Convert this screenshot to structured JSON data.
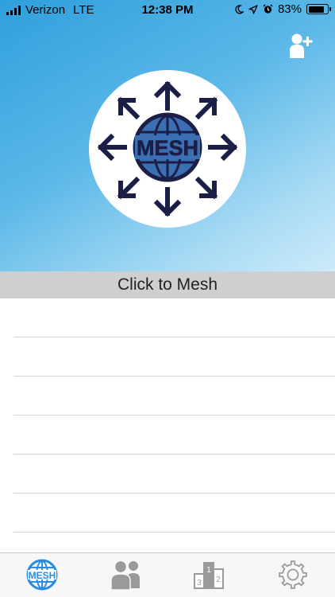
{
  "status_bar": {
    "carrier": "Verizon",
    "network": "LTE",
    "time": "12:38 PM",
    "battery": "83%",
    "battery_level": 0.83
  },
  "header": {
    "add_friend_icon": "add-person-icon"
  },
  "logo": {
    "text": "MESH",
    "icon": "globe-arrows-icon"
  },
  "mesh_button": {
    "label": "Click to Mesh"
  },
  "list": {
    "rows": [
      "",
      "",
      "",
      "",
      "",
      ""
    ]
  },
  "tab_bar": {
    "tabs": [
      {
        "icon": "mesh-globe-icon",
        "label": "MESH",
        "active": true
      },
      {
        "icon": "friends-icon",
        "active": false
      },
      {
        "icon": "leaderboard-podium-icon",
        "label_1": "1",
        "label_2": "2",
        "label_3": "3",
        "active": false
      },
      {
        "icon": "settings-gear-icon",
        "active": false
      }
    ]
  },
  "colors": {
    "accent": "#2a8be0",
    "logo_navy": "#1b1f47",
    "globe_fill": "#3b6fb4",
    "tab_inactive": "#9a9a9a"
  }
}
